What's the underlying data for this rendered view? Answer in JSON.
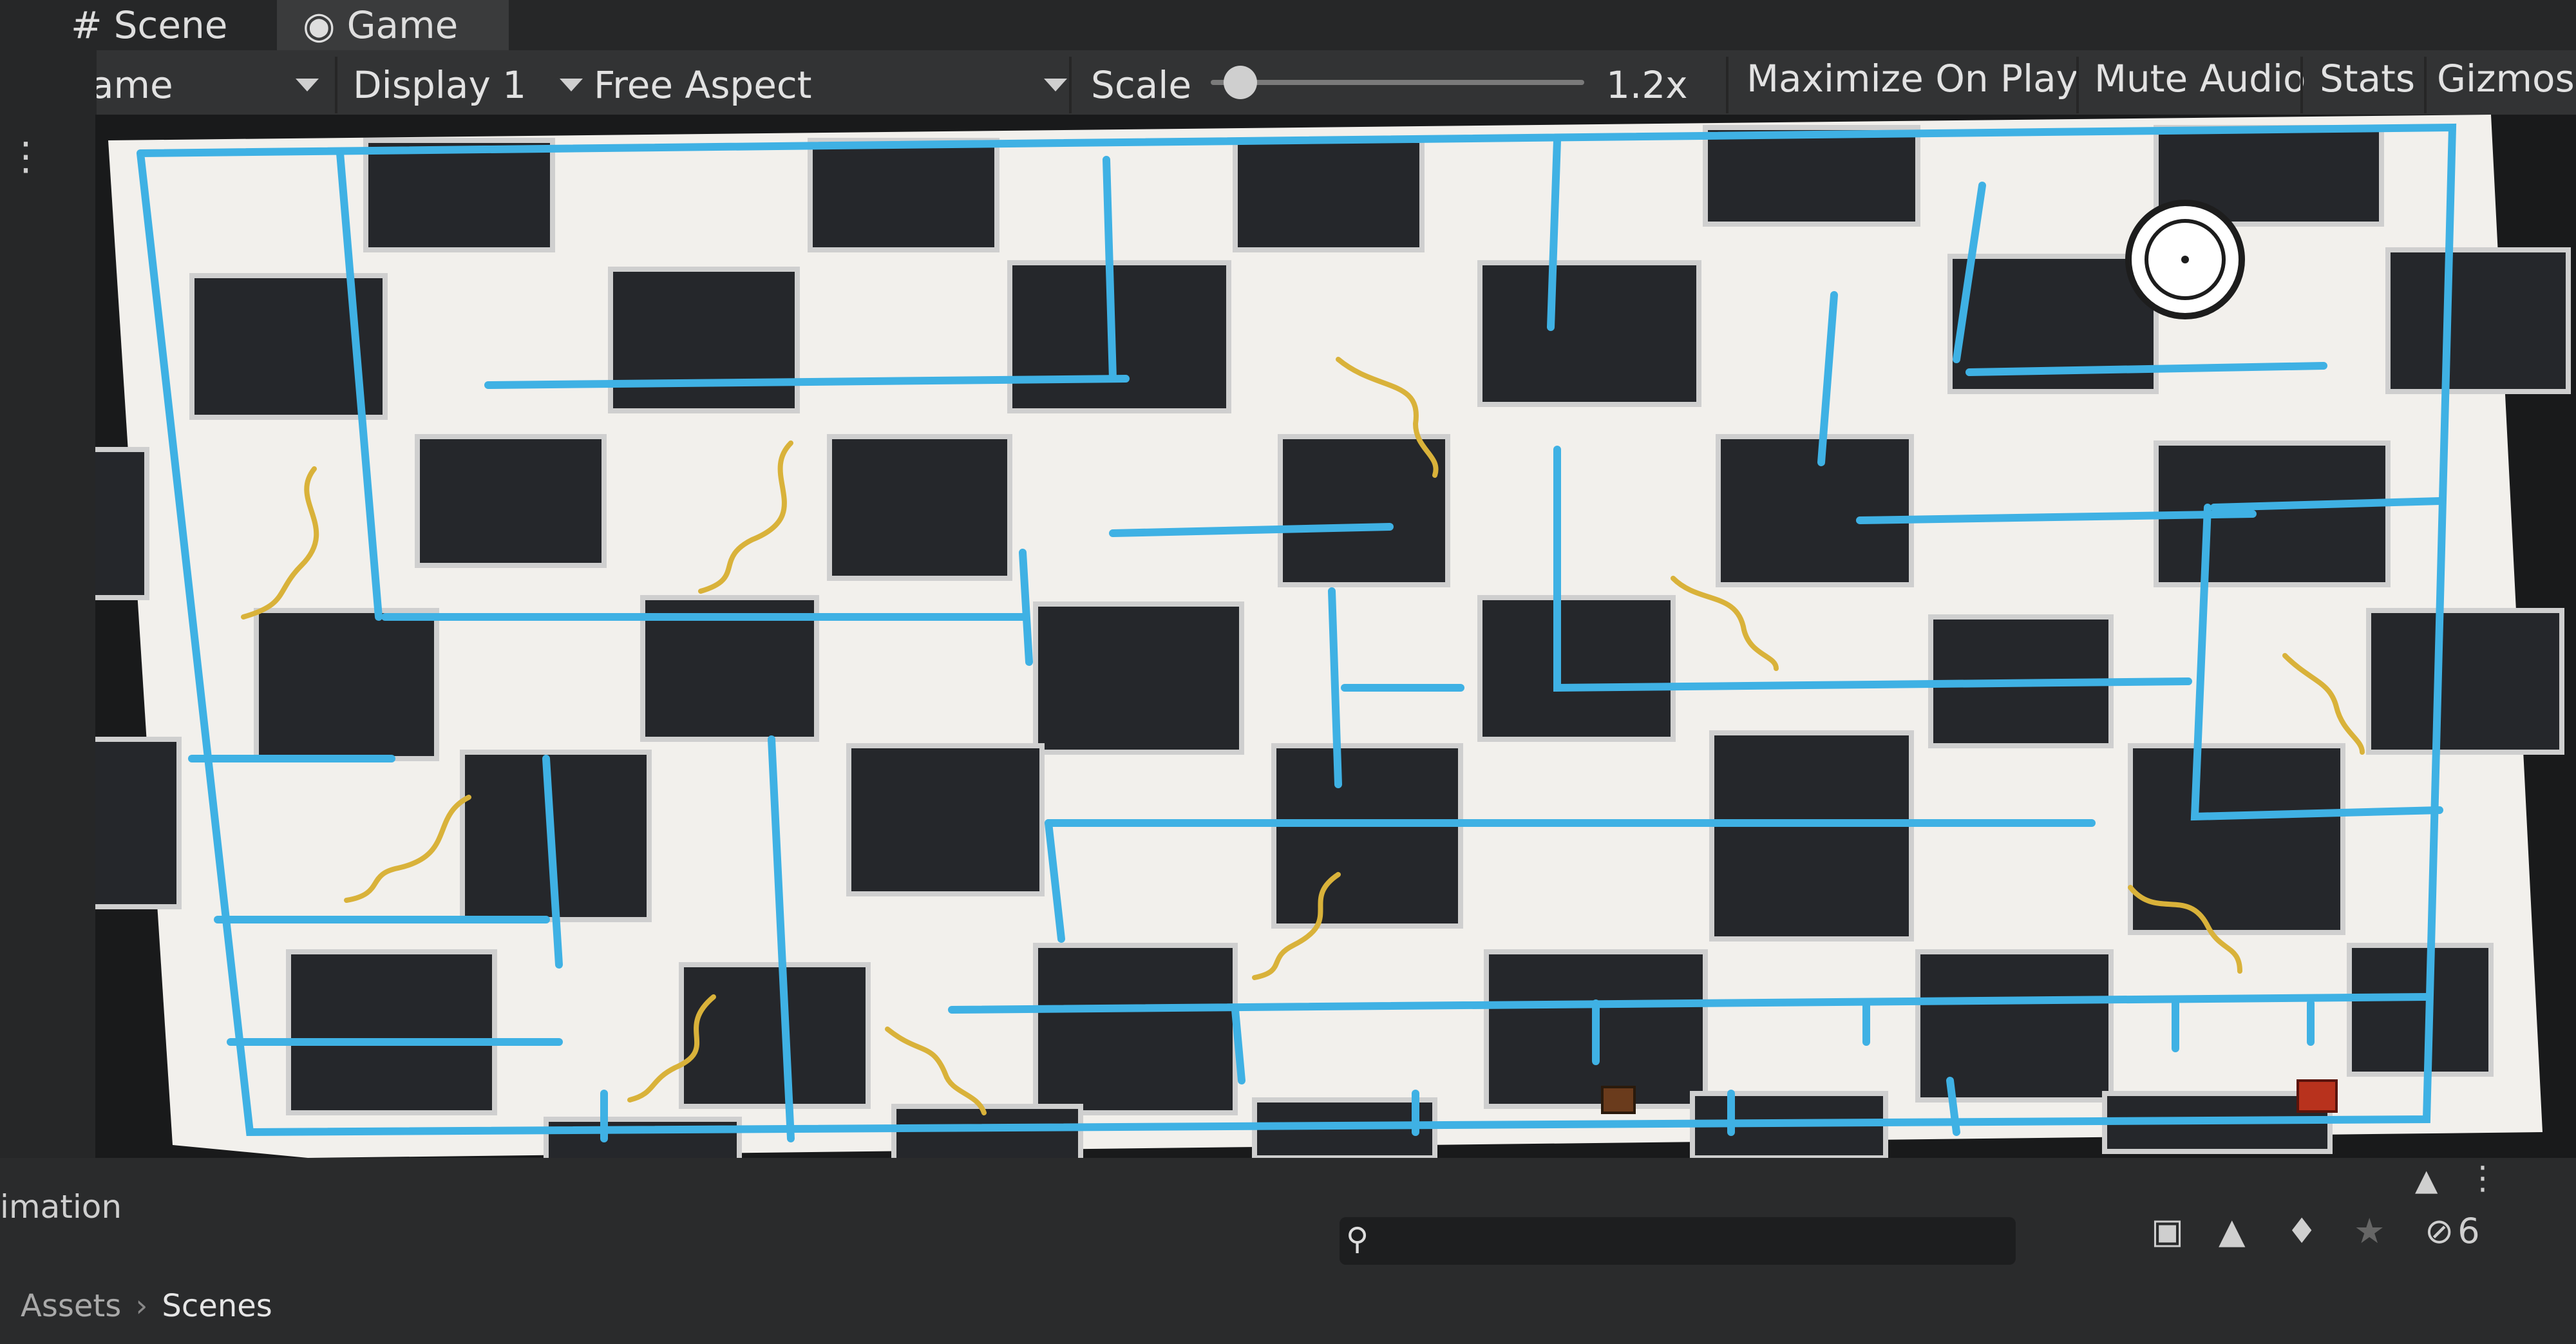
{
  "tabs": [
    {
      "label": "Scene",
      "icon": "grid-icon"
    },
    {
      "label": "Game",
      "icon": "gamepad-icon"
    }
  ],
  "toolbar": {
    "view_select": "Game",
    "display_select": "Display 1",
    "aspect_select": "Free Aspect",
    "scale_label": "Scale",
    "scale_value": "1.2x",
    "scale_fraction": 0.08,
    "maximize_on_play": "Maximize On Play",
    "mute_audio": "Mute Audio",
    "stats": "Stats",
    "gizmos": "Gizmos"
  },
  "game": {
    "colors": {
      "floor": "#f2f0ec",
      "block": "#25272b",
      "block_border": "#cfcfcf",
      "line": "#3fb1e4",
      "snake": "#d9b23a"
    }
  },
  "bottom": {
    "panel_label": "imation",
    "hidden_count": "6",
    "breadcrumb": [
      "Assets",
      "Scenes"
    ]
  },
  "colors": {
    "editor_bg": "#1f2021",
    "toolbar_bg": "#323334",
    "accent_line": "#3fb1e4"
  }
}
